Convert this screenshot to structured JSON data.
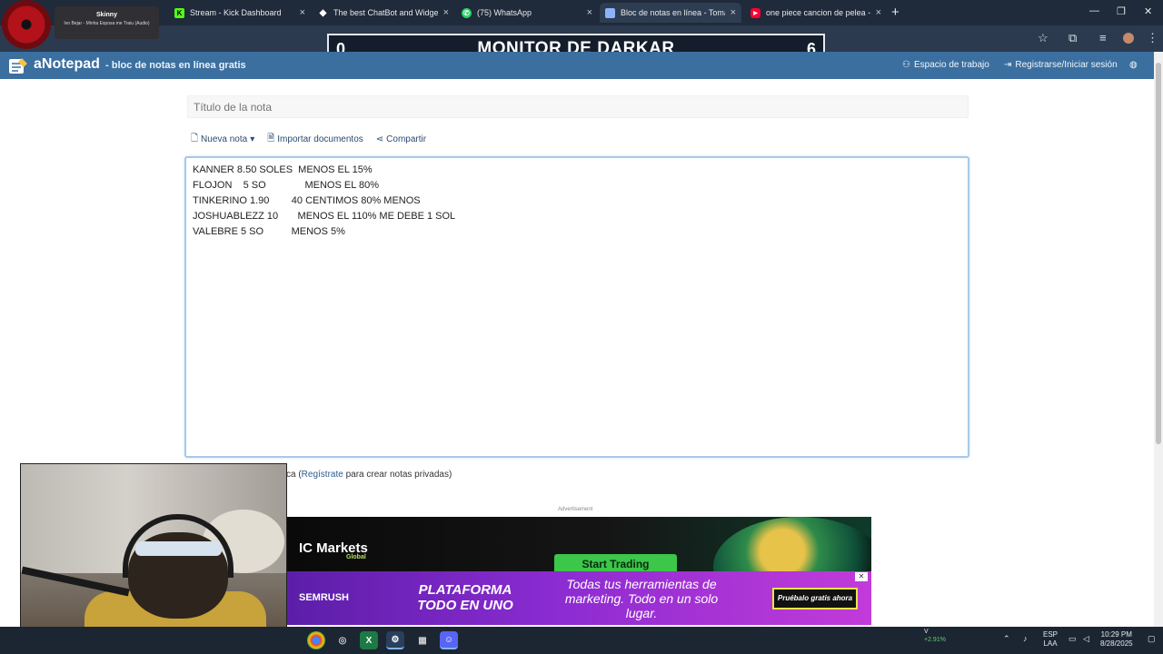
{
  "browser": {
    "tabs": [
      {
        "title": "Stream - Kick Dashboard",
        "favicon": "kick-icon",
        "color": "#53fc18",
        "active": false
      },
      {
        "title": "The best ChatBot and Widgets",
        "favicon": "botrix-icon",
        "color": "#ffffff",
        "active": false
      },
      {
        "title": "(75) WhatsApp",
        "favicon": "whatsapp-icon",
        "color": "#25d366",
        "active": false
      },
      {
        "title": "Bloc de notas en línea - Toma y",
        "favicon": "anotepad-icon",
        "color": "#8ab4f8",
        "active": true
      },
      {
        "title": "one piece cancion de pelea - Yo",
        "favicon": "youtube-icon",
        "color": "#ff0033",
        "active": false
      }
    ],
    "new_tab": "+",
    "window_controls": {
      "minimize": "—",
      "restore": "❐",
      "close": "✕"
    }
  },
  "overlay": {
    "now_playing": {
      "song": "Skinny",
      "artist": "Ivo Bejar - Minha Esposa me Traiu (Audio)"
    },
    "monitor": {
      "left_score": "0",
      "title": "MONITOR DE DARKAR",
      "right_score": "6"
    }
  },
  "app": {
    "brand": "aNotepad",
    "tagline": "- bloc de notas en línea gratis",
    "workspace_label": "Espacio de trabajo",
    "login_label": "Registrarse/Iniciar sesión",
    "accent": "#3b6fa0"
  },
  "note": {
    "title_placeholder": "Título de la nota",
    "toolbar": {
      "new_note": "Nueva nota",
      "import": "Importar documentos",
      "share": "Compartir"
    },
    "lines": [
      "KANNER 8.50 SOLES  MENOS EL 15%",
      "FLOJON    5 SO              MENOS EL 80%",
      "TINKERINO 1.90        40 CENTIMOS 80% MENOS",
      "JOSHUABLEZZ 10       MENOS EL 110% ME DEBE 1 SOL",
      "VALEBRE 5 SO          MENOS 5%"
    ],
    "public_note": {
      "prefix": "ca (",
      "link": "Regístrate",
      "suffix": " para crear notas privadas)"
    }
  },
  "ads": {
    "label": "Advertisement",
    "icmarkets": {
      "brand": "IC Markets",
      "sub": "Global",
      "cta": "Start Trading"
    },
    "semrush": {
      "brand": "SEMRUSH",
      "headline": "PLATAFORMA TODO EN UNO",
      "message": "Todas tus herramientas de marketing. Todo en un solo lugar.",
      "cta": "Pruébalo gratis ahora"
    }
  },
  "taskbar": {
    "stock": {
      "symbol": "V",
      "change": "+2.91%"
    },
    "language": {
      "lang": "ESP",
      "region": "LAA"
    },
    "time": "10:29 PM",
    "date": "8/28/2025"
  }
}
